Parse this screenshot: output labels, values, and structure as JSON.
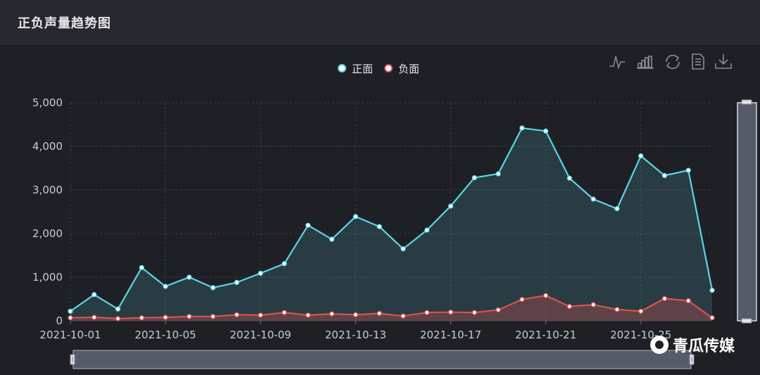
{
  "panel": {
    "title": "正负声量趋势图"
  },
  "toolbar": {
    "icons": [
      "line-chart-icon",
      "bar-chart-icon",
      "refresh-icon",
      "data-view-icon",
      "download-icon"
    ]
  },
  "watermark": {
    "text": "青瓜传媒"
  },
  "colors": {
    "positive": "#5cd6e6",
    "negative": "#d9534f",
    "background": "#1f2026",
    "grid": "#3a3c45"
  },
  "chart_data": {
    "type": "area",
    "title": "",
    "xlabel": "",
    "ylabel": "",
    "ylim": [
      0,
      5000
    ],
    "y_ticks": [
      "0",
      "1,000",
      "2,000",
      "3,000",
      "4,000",
      "5,000"
    ],
    "x_tick_labels": [
      "2021-10-01",
      "2021-10-05",
      "2021-10-09",
      "2021-10-13",
      "2021-10-17",
      "2021-10-21",
      "2021-10-25"
    ],
    "grid": true,
    "legend_position": "top-center",
    "x": [
      "2021-10-01",
      "2021-10-02",
      "2021-10-03",
      "2021-10-04",
      "2021-10-05",
      "2021-10-06",
      "2021-10-07",
      "2021-10-08",
      "2021-10-09",
      "2021-10-10",
      "2021-10-11",
      "2021-10-12",
      "2021-10-13",
      "2021-10-14",
      "2021-10-15",
      "2021-10-16",
      "2021-10-17",
      "2021-10-18",
      "2021-10-19",
      "2021-10-20",
      "2021-10-21",
      "2021-10-22",
      "2021-10-23",
      "2021-10-24",
      "2021-10-25",
      "2021-10-26",
      "2021-10-27",
      "2021-10-28"
    ],
    "series": [
      {
        "name": "正面",
        "values": [
          220,
          600,
          270,
          1220,
          790,
          1000,
          760,
          880,
          1090,
          1310,
          2190,
          1870,
          2390,
          2160,
          1650,
          2080,
          2630,
          3280,
          3370,
          4420,
          4350,
          3270,
          2790,
          2570,
          3780,
          3330,
          3450,
          700
        ]
      },
      {
        "name": "负面",
        "values": [
          70,
          80,
          50,
          70,
          80,
          100,
          100,
          140,
          130,
          190,
          130,
          160,
          140,
          170,
          110,
          190,
          200,
          190,
          250,
          490,
          580,
          330,
          370,
          260,
          220,
          510,
          460,
          70
        ]
      }
    ]
  }
}
